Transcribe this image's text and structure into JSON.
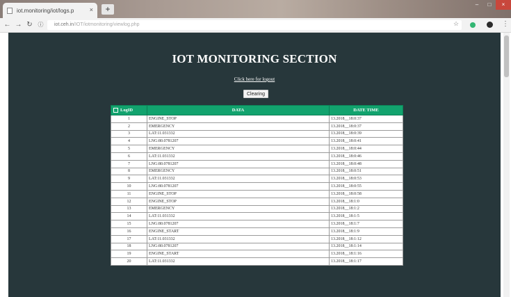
{
  "browser": {
    "tab_title": "iot.monitoring/iot/logs.p",
    "new_tab_label": "+",
    "close_label": "×",
    "url_host": "iot.ceh.in",
    "url_path": "/IOT/iotmonitoring/viewlog.php",
    "icons": {
      "back": "back-arrow-icon",
      "forward": "forward-arrow-icon",
      "reload": "reload-icon",
      "info": "info-icon",
      "star": "star-icon",
      "extension": "extension-icon",
      "profile": "profile-icon",
      "menu": "menu-icon"
    }
  },
  "page": {
    "title": "IOT MONITORING SECTION",
    "logout_link": "Click here for logout",
    "clear_button": "Clearing"
  },
  "table": {
    "columns": [
      "LogID",
      "DATA",
      "DATE   TIME"
    ],
    "rows": [
      {
        "id": "1",
        "data": "ENGINE_STOP",
        "date": "13.2018__18:0:37"
      },
      {
        "id": "2",
        "data": "EMERGENCY",
        "date": "13.2018__18:0:37"
      },
      {
        "id": "3",
        "data": "LAT:11.031332",
        "date": "13.2018__18:0:39"
      },
      {
        "id": "4",
        "data": "LNG:80.0781207",
        "date": "13.2018__18:0:41"
      },
      {
        "id": "5",
        "data": "EMERGENCY",
        "date": "13.2018__18:0:44"
      },
      {
        "id": "6",
        "data": "LAT:11.031332",
        "date": "13.2018__18:0:46"
      },
      {
        "id": "7",
        "data": "LNG:80.0781207",
        "date": "13.2018__18:0:48"
      },
      {
        "id": "8",
        "data": "EMERGENCY",
        "date": "13.2018__18:0:51"
      },
      {
        "id": "9",
        "data": "LAT:11.031332",
        "date": "13.2018__18:0:53"
      },
      {
        "id": "10",
        "data": "LNG:80.0781207",
        "date": "13.2018__18:0:55"
      },
      {
        "id": "11",
        "data": "ENGINE_STOP",
        "date": "13.2018__18:0:58"
      },
      {
        "id": "12",
        "data": "ENGINE_STOP",
        "date": "13.2018__18:1:0"
      },
      {
        "id": "13",
        "data": "EMERGENCY",
        "date": "13.2018__18:1:2"
      },
      {
        "id": "14",
        "data": "LAT:11.031332",
        "date": "13.2018__18:1:5"
      },
      {
        "id": "15",
        "data": "LNG:80.0781207",
        "date": "13.2018__18:1:7"
      },
      {
        "id": "16",
        "data": "ENGINE_START",
        "date": "13.2018__18:1:9"
      },
      {
        "id": "17",
        "data": "LAT:11.031332",
        "date": "13.2018__18:1:12"
      },
      {
        "id": "18",
        "data": "LNG:80.0781207",
        "date": "13.2018__18:1:14"
      },
      {
        "id": "19",
        "data": "ENGINE_START",
        "date": "13.2018__18:1:16"
      },
      {
        "id": "20",
        "data": "LAT:11.031332",
        "date": "13.2018__18:1:17"
      }
    ]
  },
  "colors": {
    "page_bg": "#27373b",
    "header_bg": "#12a36e",
    "title": "#ffffff"
  }
}
